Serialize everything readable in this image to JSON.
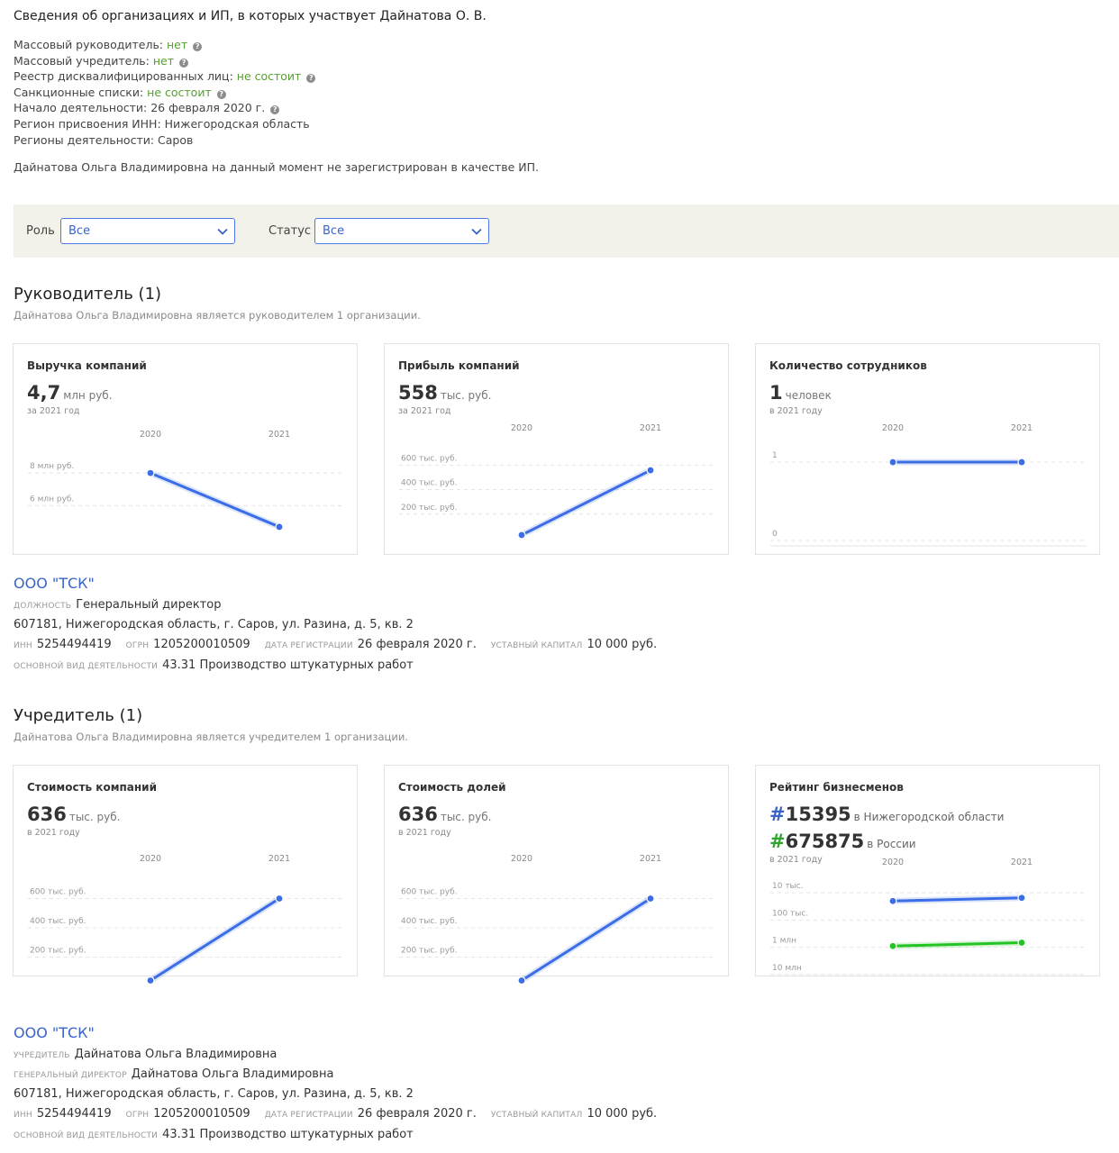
{
  "header": {
    "title": "Сведения об организациях и ИП, в которых участвует Дайнатова О. В."
  },
  "info": [
    {
      "label": "Массовый руководитель: ",
      "value": "нет",
      "value_ok": true,
      "help": true
    },
    {
      "label": "Массовый учредитель: ",
      "value": "нет",
      "value_ok": true,
      "help": true
    },
    {
      "label": "Реестр дисквалифицированных лиц: ",
      "value": "не состоит",
      "value_ok": true,
      "help": true
    },
    {
      "label": "Санкционные списки: ",
      "value": "не состоит",
      "value_ok": true,
      "help": true
    },
    {
      "label": "Начало деятельности: ",
      "value": "26 февраля 2020 г.",
      "value_ok": false,
      "help": true
    },
    {
      "label": "Регион присвоения ИНН: ",
      "value": "Нижегородская область",
      "value_ok": false,
      "help": false
    },
    {
      "label": "Регионы деятельности: ",
      "value": "Саров",
      "value_ok": false,
      "help": false
    }
  ],
  "ip_note": "Дайнатова Ольга Владимировна на данный момент не зарегистрирован в качестве ИП.",
  "filters": {
    "role_label": "Роль",
    "role_value": "Все",
    "status_label": "Статус",
    "status_value": "Все"
  },
  "colors": {
    "accent": "#3a63c9",
    "line_blue": "#3b6de6",
    "line_green": "#25c425",
    "ok_green": "#56a02f",
    "filter_bg": "#f3f2ea"
  },
  "director_section": {
    "title": "Руководитель (1)",
    "subtitle": "Дайнатова Ольга Владимировна является руководителем 1 организации."
  },
  "founder_section": {
    "title": "Учредитель (1)",
    "subtitle": "Дайнатова Ольга Владимировна является учредителем 1 организации."
  },
  "chart_data": [
    {
      "type": "line",
      "title": "Выручка компаний",
      "value": "4,7",
      "unit": "млн руб.",
      "period": "за 2021 год",
      "x": [
        "2020",
        "2021"
      ],
      "ytick_labels": [
        "8 млн руб.",
        "6 млн руб."
      ],
      "ytick_values": [
        8000000,
        6000000
      ],
      "ylim": [
        4200000,
        9000000
      ],
      "series": [
        {
          "values": [
            8000000,
            4700000
          ],
          "color": "#3b6de6"
        }
      ]
    },
    {
      "type": "line",
      "title": "Прибыль компаний",
      "value": "558",
      "unit": "тыс. руб.",
      "period": "за 2021 год",
      "x": [
        "2020",
        "2021"
      ],
      "ytick_labels": [
        "600 тыс. руб.",
        "400 тыс. руб.",
        "200 тыс. руб."
      ],
      "ytick_values": [
        600000,
        400000,
        200000
      ],
      "ylim": [
        0,
        720000
      ],
      "series": [
        {
          "values": [
            30000,
            558000
          ],
          "color": "#3b6de6"
        }
      ]
    },
    {
      "type": "line",
      "title": "Количество сотрудников",
      "value": "1",
      "unit": "человек",
      "period": "в 2021 году",
      "x": [
        "2020",
        "2021"
      ],
      "ytick_labels": [
        "1",
        "0"
      ],
      "ytick_values": [
        1,
        0
      ],
      "ylim": [
        0,
        1.15
      ],
      "series": [
        {
          "values": [
            1,
            1
          ],
          "color": "#3b6de6"
        }
      ]
    },
    {
      "type": "line",
      "title": "Стоимость компаний",
      "value": "636",
      "unit": "тыс. руб.",
      "period": "в 2021 году",
      "x": [
        "2020",
        "2021"
      ],
      "ytick_labels": [
        "600 тыс. руб.",
        "400 тыс. руб.",
        "200 тыс. руб."
      ],
      "ytick_values": [
        600000,
        400000,
        200000
      ],
      "ylim": [
        0,
        720000
      ],
      "series": [
        {
          "values": [
            40000,
            600000
          ],
          "color": "#3b6de6"
        }
      ]
    },
    {
      "type": "line",
      "title": "Стоимость долей",
      "value": "636",
      "unit": "тыс. руб.",
      "period": "в 2021 году",
      "x": [
        "2020",
        "2021"
      ],
      "ytick_labels": [
        "600 тыс. руб.",
        "400 тыс. руб.",
        "200 тыс. руб."
      ],
      "ytick_values": [
        600000,
        400000,
        200000
      ],
      "ylim": [
        0,
        720000
      ],
      "series": [
        {
          "values": [
            40000,
            600000
          ],
          "color": "#3b6de6"
        }
      ]
    },
    {
      "type": "line",
      "title": "Рейтинг бизнесменов",
      "period": "в 2021 году",
      "ranks": [
        {
          "value": "15395",
          "text": "в Нижегородской области",
          "color": "#3a63c9"
        },
        {
          "value": "675875",
          "text": "в России",
          "color": "#2fa52f"
        }
      ],
      "x": [
        "2020",
        "2021"
      ],
      "log_scale": true,
      "inverted": true,
      "ytick_labels": [
        "10 тыс.",
        "100 тыс.",
        "1 млн",
        "10 млн"
      ],
      "ytick_values": [
        10000,
        100000,
        1000000,
        10000000
      ],
      "ylim": [
        5000,
        20000000
      ],
      "series": [
        {
          "values": [
            20000,
            15395
          ],
          "color": "#3b6de6"
        },
        {
          "values": [
            900000,
            675875
          ],
          "color": "#25c425"
        }
      ]
    }
  ],
  "director_org": {
    "name": "ООО \"ТСК\"",
    "position_label": "должность",
    "position": "Генеральный директор",
    "address": "607181, Нижегородская область, г. Саров, ул. Разина, д. 5, кв. 2",
    "inn_label": "инн",
    "inn": "5254494419",
    "ogrn_label": "огрн",
    "ogrn": "1205200010509",
    "reg_label": "дата регистрации",
    "reg_date": "26 февраля 2020 г.",
    "capital_label": "уставный капитал",
    "capital": "10 000 руб.",
    "activity_label": "основной вид деятельности",
    "activity": "43.31 Производство штукатурных работ"
  },
  "founder_org": {
    "name": "ООО \"ТСК\"",
    "founder_label": "учредитель",
    "founder": "Дайнатова Ольга Владимировна",
    "director_label": "генеральный директор",
    "director": "Дайнатова Ольга Владимировна",
    "address": "607181, Нижегородская область, г. Саров, ул. Разина, д. 5, кв. 2",
    "inn_label": "инн",
    "inn": "5254494419",
    "ogrn_label": "огрн",
    "ogrn": "1205200010509",
    "reg_label": "дата регистрации",
    "reg_date": "26 февраля 2020 г.",
    "capital_label": "уставный капитал",
    "capital": "10 000 руб.",
    "activity_label": "основной вид деятельности",
    "activity": "43.31 Производство штукатурных работ"
  }
}
